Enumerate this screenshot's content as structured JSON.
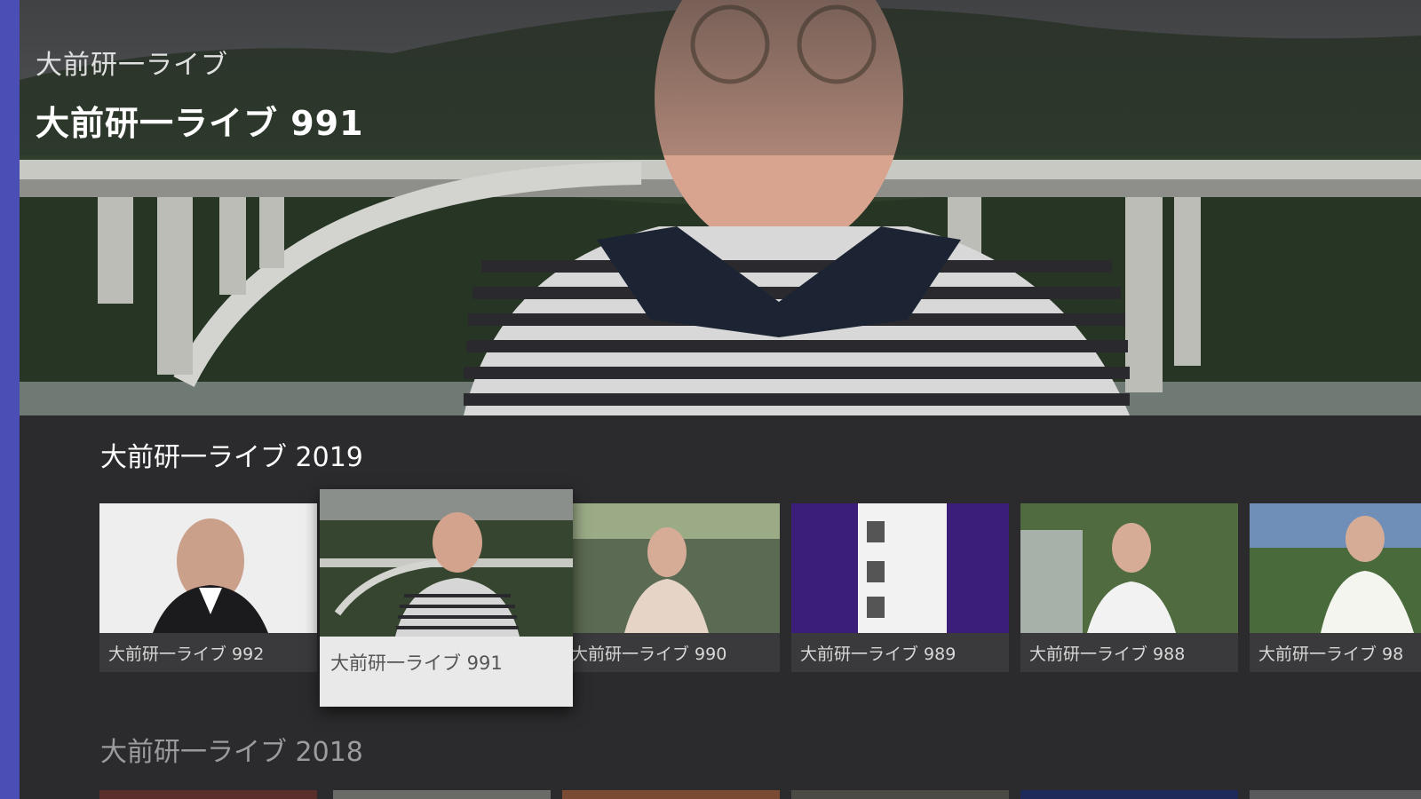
{
  "breadcrumb": "大前研一ライブ",
  "hero": {
    "title": "大前研一ライブ 991"
  },
  "rows": [
    {
      "header": "大前研一ライブ 2019",
      "items": [
        {
          "label": "大前研一ライブ 992"
        },
        {
          "label": "大前研一ライブ 991",
          "focused": true
        },
        {
          "label": "大前研一ライブ 990"
        },
        {
          "label": "大前研一ライブ 989"
        },
        {
          "label": "大前研一ライブ 988"
        },
        {
          "label": "大前研一ライブ 98"
        }
      ]
    },
    {
      "header": "大前研一ライブ 2018"
    }
  ],
  "colors": {
    "accent_rail": "#4b4fb5",
    "background": "#2b2b2d",
    "card_bg": "#3a3a3c",
    "focused_card_bg": "#e9e9e9"
  }
}
